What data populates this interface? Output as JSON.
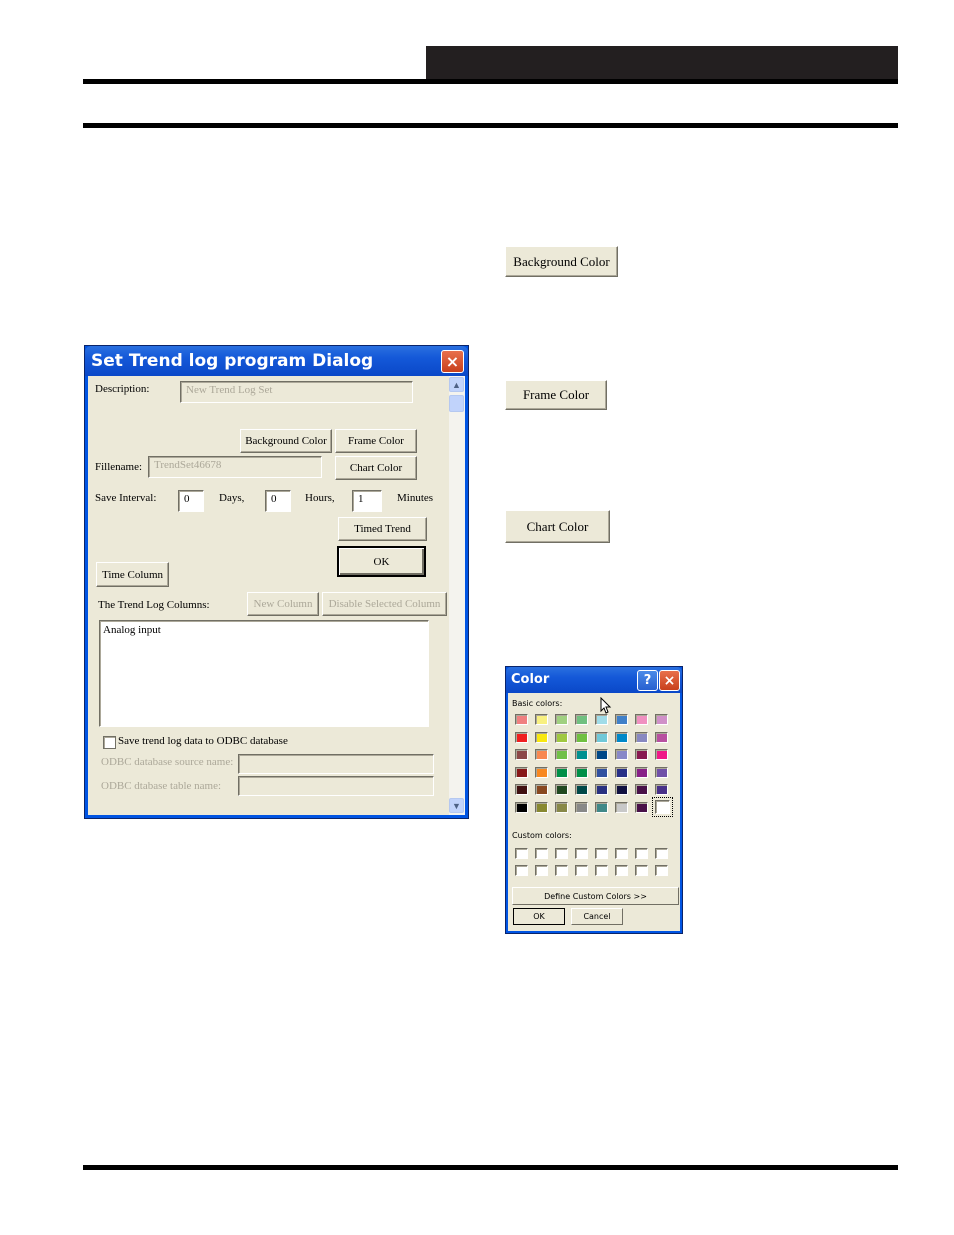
{
  "page": {
    "header_block": "",
    "standalone_buttons": {
      "background_color": "Background Color",
      "frame_color": "Frame Color",
      "chart_color": "Chart Color"
    }
  },
  "trend_dialog": {
    "title": "Set Trend  log program Dialog",
    "close_icon": "×",
    "description_label": "Description:",
    "description_value": "New Trend Log Set",
    "background_color_button": "Background Color",
    "frame_color_button": "Frame Color",
    "chart_color_button": "Chart Color",
    "filename_label": "Fillename:",
    "filename_value": "TrendSet46678",
    "save_interval_label": "Save Interval:",
    "days_value": "0",
    "days_label": "Days,",
    "hours_value": "0",
    "hours_label": "Hours,",
    "minutes_value": "1",
    "minutes_label": "Minutes",
    "timed_trend_button": "Timed Trend",
    "ok_button": "OK",
    "time_column_button": "Time Column",
    "columns_label": "The Trend Log Columns:",
    "new_column_button": "New Column",
    "disable_column_button": "Disable Selected Column",
    "columns_list": [
      "Analog input"
    ],
    "odbc_checkbox_label": "Save trend log data to ODBC database",
    "odbc_checked": false,
    "odbc_source_label": "ODBC database source name:",
    "odbc_source_value": "",
    "odbc_table_label": "ODBC dtabase table name:",
    "odbc_table_value": "",
    "scroll_up_icon": "▲",
    "scroll_down_icon": "▼"
  },
  "color_dialog": {
    "title": "Color",
    "help_icon": "?",
    "close_icon": "×",
    "basic_colors_label": "Basic colors:",
    "basic_colors": [
      [
        "#f08080",
        "#f8f080",
        "#a0d080",
        "#70c080",
        "#a0dce8",
        "#4080c8",
        "#f090c0",
        "#d090c8"
      ],
      [
        "#f02020",
        "#f8e810",
        "#a0c840",
        "#70c040",
        "#70c8d8",
        "#0088c8",
        "#8888c0",
        "#b850a0"
      ],
      [
        "#8c4848",
        "#f88850",
        "#70c048",
        "#009090",
        "#004888",
        "#8888c8",
        "#881850",
        "#f01888"
      ],
      [
        "#881818",
        "#f88820",
        "#009048",
        "#009048",
        "#3050a0",
        "#283088",
        "#882088",
        "#7050a8"
      ],
      [
        "#401010",
        "#884820",
        "#204820",
        "#004848",
        "#283080",
        "#101040",
        "#481048",
        "#483088"
      ],
      [
        "#000000",
        "#888830",
        "#888848",
        "#888888",
        "#408888",
        "#c8c8c8",
        "#481048",
        "#ffffff"
      ]
    ],
    "selected_color": "#ffffff",
    "custom_colors_label": "Custom colors:",
    "custom_colors": [
      [
        "#ffffff",
        "#ffffff",
        "#ffffff",
        "#ffffff",
        "#ffffff",
        "#ffffff",
        "#ffffff",
        "#ffffff"
      ],
      [
        "#ffffff",
        "#ffffff",
        "#ffffff",
        "#ffffff",
        "#ffffff",
        "#ffffff",
        "#ffffff",
        "#ffffff"
      ]
    ],
    "define_custom_button": "Define Custom Colors >>",
    "ok_button": "OK",
    "cancel_button": "Cancel"
  }
}
